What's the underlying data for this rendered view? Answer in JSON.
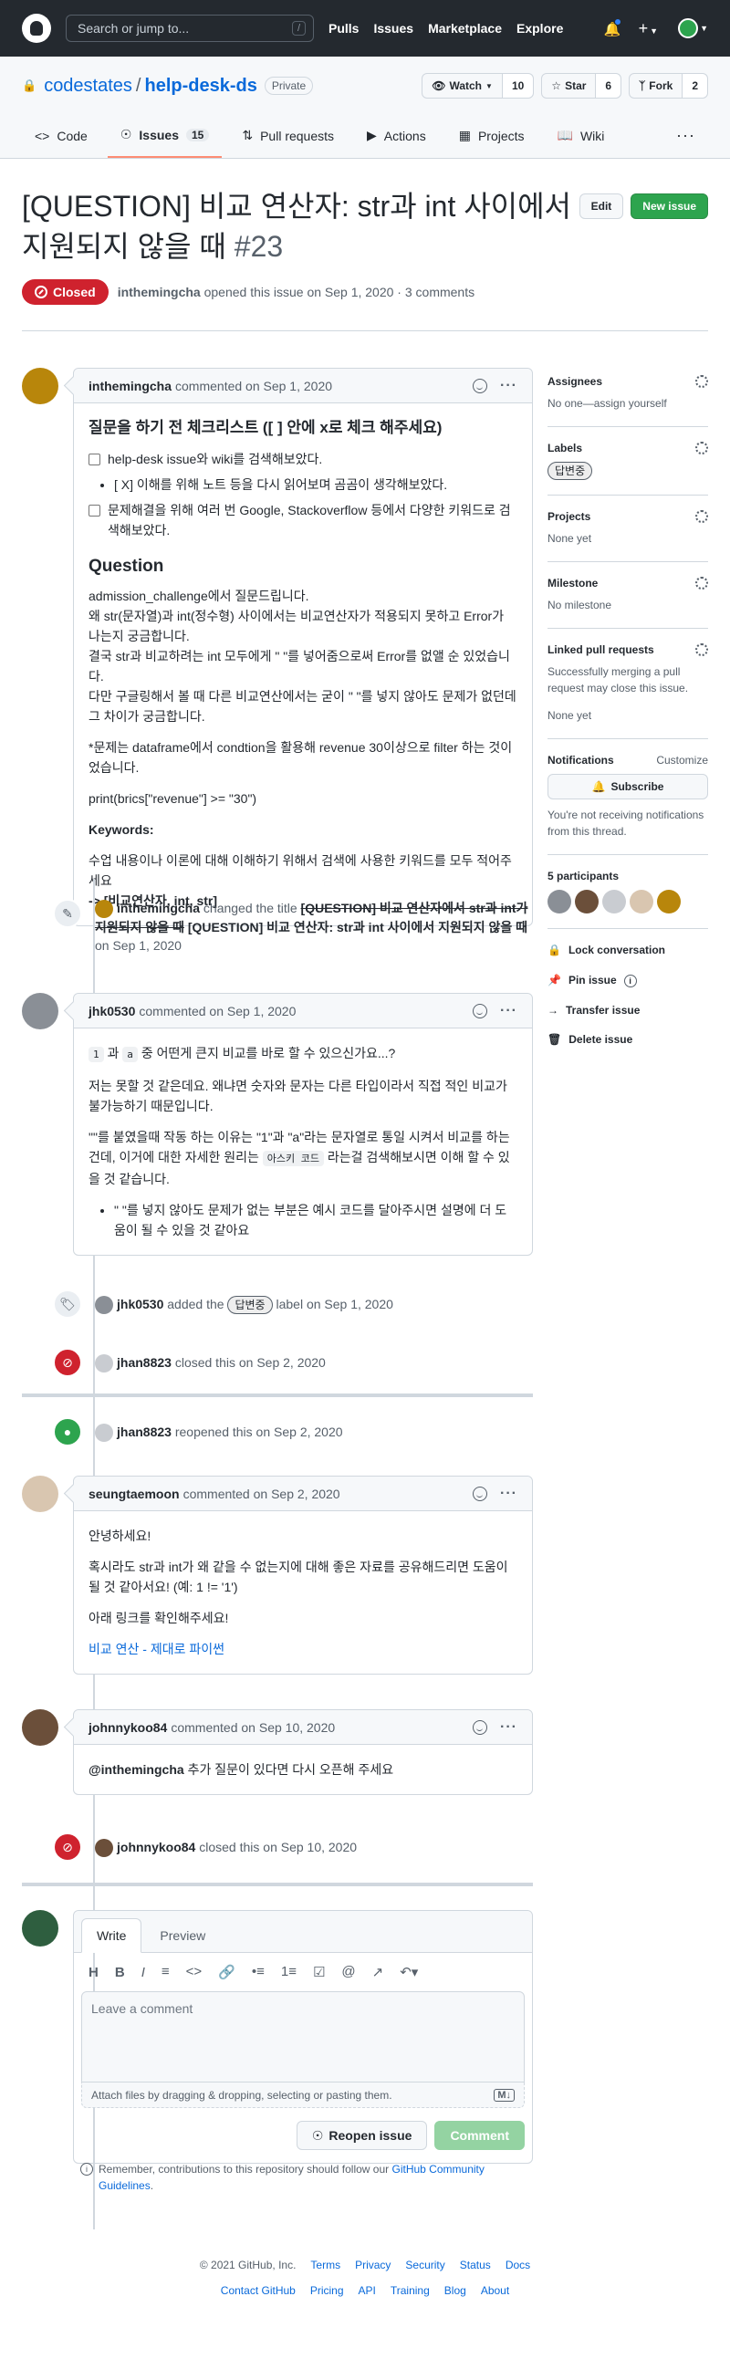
{
  "header": {
    "search_placeholder": "Search or jump to...",
    "search_shortcut": "/",
    "nav": [
      "Pulls",
      "Issues",
      "Marketplace",
      "Explore"
    ]
  },
  "repo": {
    "owner": "codestates",
    "separator": "/",
    "name": "help-desk-ds",
    "visibility": "Private",
    "watch_label": "Watch",
    "watch_count": "10",
    "star_label": "Star",
    "star_count": "6",
    "fork_label": "Fork",
    "fork_count": "2",
    "tabs": [
      {
        "label": "Code"
      },
      {
        "label": "Issues",
        "count": "15"
      },
      {
        "label": "Pull requests"
      },
      {
        "label": "Actions"
      },
      {
        "label": "Projects"
      },
      {
        "label": "Wiki"
      }
    ],
    "more": "···"
  },
  "issue": {
    "title": "[QUESTION] 비교 연산자: str과 int 사이에서 지원되지 않을 때",
    "number": "#23",
    "edit_label": "Edit",
    "new_issue_label": "New issue",
    "state": "Closed",
    "author": "inthemingcha",
    "meta": "opened this issue on Sep 1, 2020 · 3 comments"
  },
  "comment1": {
    "author": "inthemingcha",
    "meta": "commented on Sep 1, 2020",
    "checklist_title": "질문을 하기 전 체크리스트 ([ ] 안에 x로 체크 해주세요)",
    "check1": "help-desk issue와 wiki를 검색해보았다.",
    "check2": "[ X] 이해를 위해 노트 등을 다시 읽어보며 곰곰이 생각해보았다.",
    "check3": "문제해결을 위해 여러 번 Google, Stackoverflow 등에서 다양한 키워드로 검색해보았다.",
    "question_heading": "Question",
    "p1_line1": "admission_challenge에서 질문드립니다.",
    "p1_line2": "왜 str(문자열)과 int(정수형) 사이에서는 비교연산자가 적용되지 못하고 Error가 나는지 궁금합니다.",
    "p1_line3": "결국 str과 비교하려는 int 모두에게 \" \"를 넣어줌으로써 Error를 없앨 순 있었습니다.",
    "p1_line4": "다만 구글링해서 볼 때 다른 비교연산에서는 굳이 \" \"를 넣지 않아도 문제가 없던데 그 차이가 궁금합니다.",
    "p2": "*문제는 dataframe에서 condtion을 활용해 revenue 30이상으로 filter 하는 것이었습니다.",
    "code_line": "print(brics[\"revenue\"] >= \"30\")",
    "keywords_heading": "Keywords:",
    "keywords_line1": "수업 내용이나 이론에 대해 이해하기 위해서 검색에 사용한 키워드를 모두 적어주세요",
    "keywords_line2": "-> [비교연산자, int, str]"
  },
  "event_rename": {
    "author": "inthemingcha",
    "action": "changed the title",
    "old_title": "[QUESTION] 비교 연산자에서 str과 int가 지원되지 않을 때",
    "new_title": "[QUESTION] 비교 연산자: str과 int 사이에서 지원되지 않을 때",
    "date": "on Sep 1, 2020"
  },
  "comment2": {
    "author": "jhk0530",
    "meta": "commented on Sep 1, 2020",
    "code1": "1",
    "mid1": "과",
    "code2": "a",
    "line1_tail": "중 어떤게 큰지 비교를 바로 할 수 있으신가요...?",
    "p2": "저는 못할 것 같은데요. 왜냐면 숫자와 문자는 다른 타입이라서 직접 적인 비교가 불가능하기 때문입니다.",
    "p3_a": "\"\"를 붙였을때 작동 하는 이유는 \"1\"과 \"a\"라는 문자열로 통일 시켜서 비교를 하는 건데, 이거에 대한 자세한 원리는",
    "code3": "아스키 코드",
    "p3_b": "라는걸 검색해보시면 이해 할 수 있을 것 같습니다.",
    "bullet": "\" \"를 넣지 않아도 문제가 없는 부분은 예시 코드를 달아주시면 설명에 더 도움이 될 수 있을 것 같아요"
  },
  "event_label": {
    "author": "jhk0530",
    "action": "added the",
    "label": "답변중",
    "tail": "label on Sep 1, 2020"
  },
  "event_closed1": {
    "author": "jhan8823",
    "text": "closed this on Sep 2, 2020"
  },
  "event_reopened": {
    "author": "jhan8823",
    "text": "reopened this on Sep 2, 2020"
  },
  "comment3": {
    "author": "seungtaemoon",
    "meta": "commented on Sep 2, 2020",
    "p1": "안녕하세요!",
    "p2": "혹시라도 str과 int가 왜 같을 수 없는지에 대해 좋은 자료를 공유해드리면 도움이 될 것 같아서요! (예: 1 != '1')",
    "p3": "아래 링크를 확인해주세요!",
    "link": "비교 연산 - 제대로 파이썬"
  },
  "comment4": {
    "author": "johnnykoo84",
    "meta": "commented on Sep 10, 2020",
    "mention": "@inthemingcha",
    "text": "추가 질문이 있다면 다시 오픈해 주세요"
  },
  "event_closed2": {
    "author": "johnnykoo84",
    "text": "closed this on Sep 10, 2020"
  },
  "composer": {
    "tab_write": "Write",
    "tab_preview": "Preview",
    "placeholder": "Leave a comment",
    "attach": "Attach files by dragging & dropping, selecting or pasting them.",
    "reopen_label": "Reopen issue",
    "comment_label": "Comment",
    "remember_a": "Remember, contributions to this repository should follow our",
    "remember_link": "GitHub Community Guidelines",
    "remember_end": "."
  },
  "sidebar": {
    "assignees_title": "Assignees",
    "assignees_value": "No one—assign yourself",
    "labels_title": "Labels",
    "label_value": "답변중",
    "projects_title": "Projects",
    "projects_value": "None yet",
    "milestone_title": "Milestone",
    "milestone_value": "No milestone",
    "linked_title": "Linked pull requests",
    "linked_desc": "Successfully merging a pull request may close this issue.",
    "linked_value": "None yet",
    "notif_title": "Notifications",
    "notif_customize": "Customize",
    "subscribe": "Subscribe",
    "notif_desc": "You're not receiving notifications from this thread.",
    "participants_title": "5 participants",
    "lock": "Lock conversation",
    "pin": "Pin issue",
    "transfer": "Transfer issue",
    "delete": "Delete issue"
  },
  "footer": {
    "copyright": "© 2021 GitHub, Inc.",
    "row1": [
      "Terms",
      "Privacy",
      "Security",
      "Status",
      "Docs"
    ],
    "row2": [
      "Contact GitHub",
      "Pricing",
      "API",
      "Training",
      "Blog",
      "About"
    ]
  }
}
